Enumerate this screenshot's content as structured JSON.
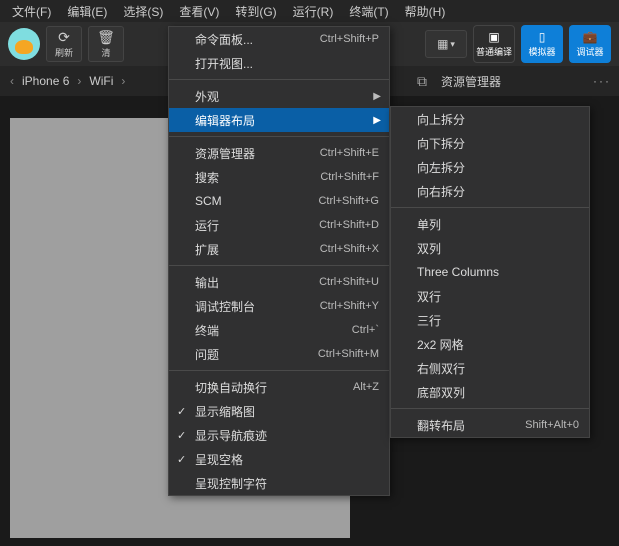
{
  "menubar": [
    "文件(F)",
    "编辑(E)",
    "选择(S)",
    "查看(V)",
    "转到(G)",
    "运行(R)",
    "终端(T)",
    "帮助(H)"
  ],
  "toolbar": {
    "refresh": "刷新",
    "clear": "清",
    "compile": "普通编译",
    "simulator": "模拟器",
    "debugger": "调试器"
  },
  "breadcrumb": {
    "device": "iPhone 6",
    "net": "WiFi"
  },
  "tab": {
    "title": "资源管理器"
  },
  "menu1": [
    {
      "label": "命令面板...",
      "sc": "Ctrl+Shift+P"
    },
    {
      "label": "打开视图..."
    },
    {
      "sep": true
    },
    {
      "label": "外观",
      "arrow": true
    },
    {
      "label": "编辑器布局",
      "arrow": true,
      "hl": true
    },
    {
      "sep": true
    },
    {
      "label": "资源管理器",
      "sc": "Ctrl+Shift+E"
    },
    {
      "label": "搜索",
      "sc": "Ctrl+Shift+F"
    },
    {
      "label": "SCM",
      "sc": "Ctrl+Shift+G"
    },
    {
      "label": "运行",
      "sc": "Ctrl+Shift+D"
    },
    {
      "label": "扩展",
      "sc": "Ctrl+Shift+X"
    },
    {
      "sep": true
    },
    {
      "label": "输出",
      "sc": "Ctrl+Shift+U"
    },
    {
      "label": "调试控制台",
      "sc": "Ctrl+Shift+Y"
    },
    {
      "label": "终端",
      "sc": "Ctrl+`"
    },
    {
      "label": "问题",
      "sc": "Ctrl+Shift+M"
    },
    {
      "sep": true
    },
    {
      "label": "切换自动换行",
      "sc": "Alt+Z"
    },
    {
      "label": "显示缩略图",
      "check": true
    },
    {
      "label": "显示导航痕迹",
      "check": true
    },
    {
      "label": "呈现空格",
      "check": true
    },
    {
      "label": "呈现控制字符"
    }
  ],
  "menu2": [
    {
      "label": "向上拆分"
    },
    {
      "label": "向下拆分"
    },
    {
      "label": "向左拆分"
    },
    {
      "label": "向右拆分"
    },
    {
      "sep": true
    },
    {
      "label": "单列"
    },
    {
      "label": "双列"
    },
    {
      "label": "Three Columns"
    },
    {
      "label": "双行"
    },
    {
      "label": "三行"
    },
    {
      "label": "2x2 网格"
    },
    {
      "label": "右侧双行"
    },
    {
      "label": "底部双列"
    },
    {
      "sep": true
    },
    {
      "label": "翻转布局",
      "sc": "Shift+Alt+0"
    }
  ]
}
